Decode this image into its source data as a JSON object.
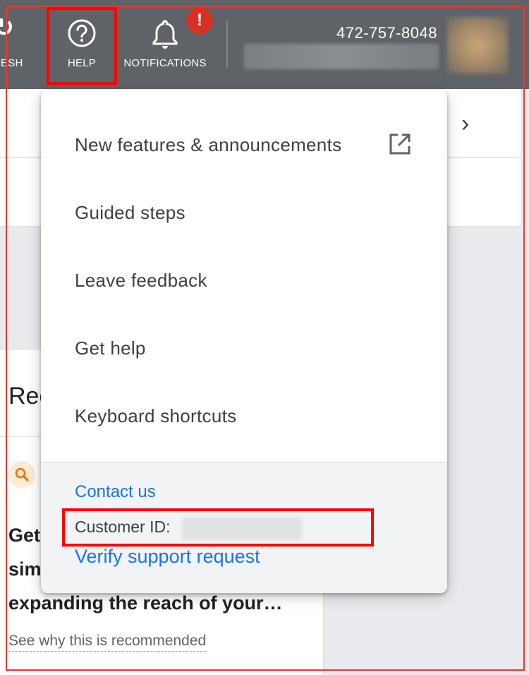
{
  "topbar": {
    "refresh_label": "RESH",
    "help_label": "HELP",
    "notifications_label": "NOTIFICATIONS",
    "notification_badge": "!",
    "phone": "472-757-8048",
    "background": "#5f6368",
    "alert_color": "#d93025"
  },
  "menu": {
    "items": [
      {
        "label": "New features & announcements",
        "icon": "open-in-new-icon"
      },
      {
        "label": "Guided steps"
      },
      {
        "label": "Leave feedback"
      },
      {
        "label": "Get help"
      },
      {
        "label": "Keyboard shortcuts"
      }
    ],
    "footer": {
      "contact_label": "Contact us",
      "customer_id_label": "Customer ID:",
      "verify_label": "Verify support request",
      "link_color": "#1a73e8"
    }
  },
  "card": {
    "title_partial": "Rec",
    "body_line1": "Get",
    "body_line2": "sim",
    "body_line3": "expanding the reach of your…",
    "see_why": "See why this is recommended"
  },
  "highlight_color": "#ff0000"
}
